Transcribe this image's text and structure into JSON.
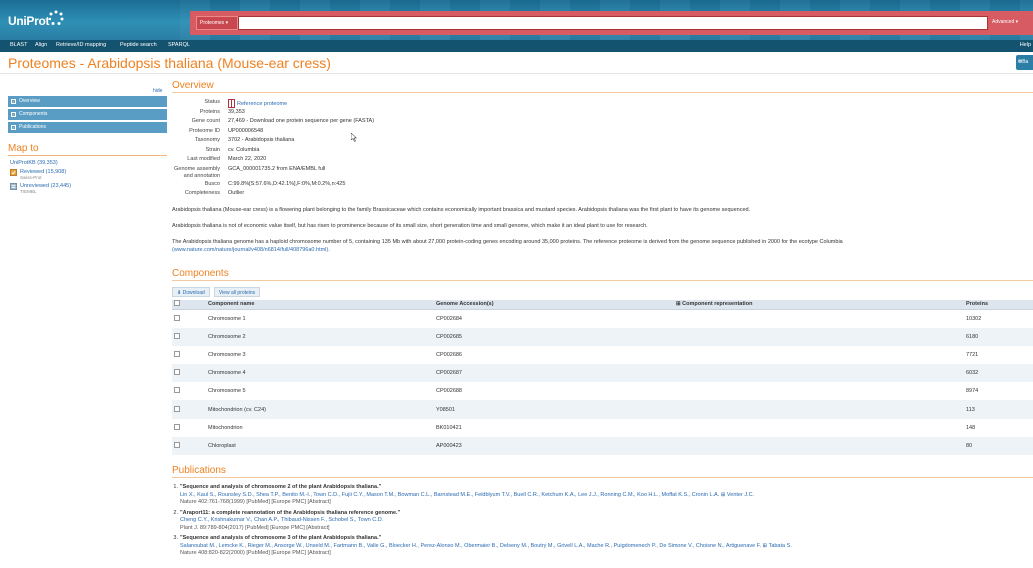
{
  "header": {
    "logo_text": "UniProt",
    "search_scope": "Proteomes ▾",
    "search_value": "",
    "advanced_label": "Advanced ▾",
    "nav": [
      "BLAST",
      "Align",
      "Retrieve/ID mapping",
      "Peptide search",
      "SPARQL"
    ],
    "help": "Help"
  },
  "page": {
    "title": "Proteomes - Arabidopsis thaliana (Mouse-ear cress)",
    "basket_label": "Ba"
  },
  "sidebar": {
    "hide_label": "hide",
    "items": [
      {
        "label": "Overview"
      },
      {
        "label": "Components"
      },
      {
        "label": "Publications"
      }
    ],
    "map_title": "Map to",
    "uniprotkb": "UniProtKB (39,353)",
    "reviewed": "Reviewed (15,908)",
    "reviewed_sub": "Swiss-Prot",
    "unreviewed": "Unreviewed (23,445)",
    "unreviewed_sub": "TrEMBL"
  },
  "overview": {
    "title": "Overview",
    "rows": [
      {
        "label": "Status",
        "value": "Reference proteome"
      },
      {
        "label": "Proteins",
        "value": "39,353"
      },
      {
        "label": "Gene count",
        "value": "27,469 - Download one protein sequence per gene (FASTA)"
      },
      {
        "label": "Proteome ID",
        "value": "UP000006548"
      },
      {
        "label": "Taxonomy",
        "value": "3702 - Arabidopsis thaliana"
      },
      {
        "label": "Strain",
        "value": "cv. Columbia"
      },
      {
        "label": "Last modified",
        "value": "March 22, 2020"
      },
      {
        "label": "Genome assembly and annotation",
        "value": "GCA_000001735.2 from ENA/EMBL full"
      },
      {
        "label": "Busco",
        "value": "C:99.8%[S:57.6%,D:42.1%],F:0%,M:0.2%,n:425"
      },
      {
        "label": "Completeness",
        "value": "Outlier"
      }
    ],
    "desc1": "Arabidopsis thaliana (Mouse-ear cress) is a flowering plant belonging to the family Brassicaceae which contains economically important brassica and mustard species. Arabidopsis thaliana was the first plant to have its genome sequenced.",
    "desc2": "Arabidopsis thaliana is not of economic value itself, but has risen to prominence because of its small size, short generation time and small genome, which make it an ideal plant to use for research.",
    "desc3": "The Arabidopsis thaliana genome has a haploid chromosome number of 5, containing 135 Mb with about 27,000 protein-coding genes encoding around 35,000 proteins. The reference proteome is derived from the genome sequence published in 2000 for the ecotype Columbia",
    "desc3_link": "(www.nature.com/nature/journal/v408/n6814/full/408796a0.html)."
  },
  "components": {
    "title": "Components",
    "download_label": "Download",
    "view_all_label": "View all proteins",
    "columns": [
      "Component name",
      "Genome Accession(s)",
      "Component representation",
      "Proteins"
    ],
    "rows": [
      {
        "name": "Chromosome 1",
        "accession": "CP002684",
        "proteins": "10302"
      },
      {
        "name": "Chromosome 2",
        "accession": "CP002685",
        "proteins": "6180"
      },
      {
        "name": "Chromosome 3",
        "accession": "CP002686",
        "proteins": "7721"
      },
      {
        "name": "Chromosome 4",
        "accession": "CP002687",
        "proteins": "6032"
      },
      {
        "name": "Chromosome 5",
        "accession": "CP002688",
        "proteins": "8974"
      },
      {
        "name": "Mitochondrion (cv. C24)",
        "accession": "Y08501",
        "proteins": "113"
      },
      {
        "name": "Mitochondrion",
        "accession": "BK010421",
        "proteins": "148"
      },
      {
        "name": "Chloroplast",
        "accession": "AP000423",
        "proteins": "80"
      }
    ]
  },
  "publications": {
    "title": "Publications",
    "items": [
      {
        "num": "1.",
        "title": "\"Sequence and analysis of chromosome 2 of the plant Arabidopsis thaliana.\"",
        "authors": "Lin X., Kaul S., Rounsley S.D., Shea T.P., Benito M.-I., Town C.D., Fujii C.Y., Mason T.M., Bowman C.L., Barnstead M.E., Feldblyum T.V., Buell C.R., Ketchum K.A., Lee J.J., Ronning C.M., Koo H.L., Moffat K.S., Cronin L.A. ⊞ Venter J.C.",
        "journal": "Nature 402:761-768(1999) [PubMed] [Europe PMC] [Abstract]"
      },
      {
        "num": "2.",
        "title": "\"Araport11: a complete reannotation of the Arabidopsis thaliana reference genome.\"",
        "authors": "Cheng C.Y., Krishnakumar V., Chan A.P., Thibaud-Nissen F., Schobel S., Town C.D.",
        "journal": "Plant J. 89:789-804(2017) [PubMed] [Europe PMC] [Abstract]"
      },
      {
        "num": "3.",
        "title": "\"Sequence and analysis of chromosome 3 of the plant Arabidopsis thaliana.\"",
        "authors": "Salanoubat M., Lemcke K., Rieger M., Ansorge W., Unseld M., Fartmann B., Valle G., Bloecker H., Perez-Alonso M., Obermaier B., Delseny M., Boutry M., Grivell L.A., Mache R., Puigdomenech P., De Simone V., Choisne N., Artiguenave F. ⊞ Tabata S.",
        "journal": "Nature 408:820-822(2000) [PubMed] [Europe PMC] [Abstract]"
      }
    ]
  },
  "colors": {
    "header": "#2f8fb5",
    "search_bar": "#d65b63",
    "title_orange": "#ee8120",
    "link": "#2a6ab1",
    "sidebar_item": "#5a9dc4"
  }
}
